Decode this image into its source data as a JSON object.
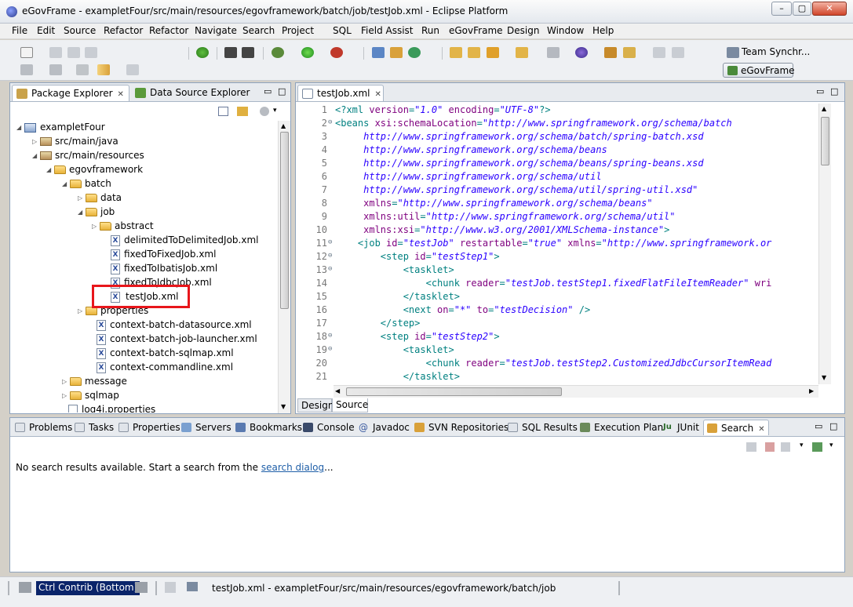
{
  "window": {
    "title": "eGovFrame - exampletFour/src/main/resources/egovframework/batch/job/testJob.xml - Eclipse Platform"
  },
  "menu": [
    "File",
    "Edit",
    "Source",
    "Refactor",
    "Refactor",
    "Navigate",
    "Search",
    "Project",
    "SQL",
    "Field Assist",
    "Run",
    "eGovFrame",
    "Design",
    "Window",
    "Help"
  ],
  "perspectives": {
    "team": "Team Synchr...",
    "egov": "eGovFrame"
  },
  "left_panel": {
    "tabs": [
      "Package Explorer",
      "Data Source Explorer"
    ],
    "tree": [
      {
        "label": "exampletFour",
        "type": "project",
        "expanded": true
      },
      {
        "label": "src/main/java",
        "type": "pkg",
        "expanded": false
      },
      {
        "label": "src/main/resources",
        "type": "pkg",
        "expanded": true
      },
      {
        "label": "egovframework",
        "type": "folder",
        "expanded": true
      },
      {
        "label": "batch",
        "type": "folder",
        "expanded": true
      },
      {
        "label": "data",
        "type": "folder",
        "expanded": false
      },
      {
        "label": "job",
        "type": "folder",
        "expanded": true
      },
      {
        "label": "abstract",
        "type": "folder",
        "expanded": false
      },
      {
        "label": "delimitedToDelimitedJob.xml",
        "type": "xml"
      },
      {
        "label": "fixedToFixedJob.xml",
        "type": "xml"
      },
      {
        "label": "fixedToIbatisJob.xml",
        "type": "xml"
      },
      {
        "label": "fixedToJdbcJob.xml",
        "type": "xml"
      },
      {
        "label": "testJob.xml",
        "type": "xml",
        "selected": true
      },
      {
        "label": "properties",
        "type": "folder",
        "expanded": false
      },
      {
        "label": "context-batch-datasource.xml",
        "type": "xml"
      },
      {
        "label": "context-batch-job-launcher.xml",
        "type": "xml"
      },
      {
        "label": "context-batch-sqlmap.xml",
        "type": "xml"
      },
      {
        "label": "context-commandline.xml",
        "type": "xml"
      },
      {
        "label": "message",
        "type": "folder",
        "expanded": false
      },
      {
        "label": "sqlmap",
        "type": "folder",
        "expanded": false
      },
      {
        "label": "log4j.properties",
        "type": "file"
      }
    ]
  },
  "editor": {
    "tab": "testJob.xml",
    "bottom_tabs": [
      "Design",
      "Source"
    ],
    "lines": [
      {
        "n": "1",
        "fold": "",
        "tokens": [
          [
            "p",
            "<?xml "
          ],
          [
            "a",
            "version"
          ],
          [
            "p",
            "="
          ],
          [
            "v",
            "\"1.0\""
          ],
          [
            "p",
            " "
          ],
          [
            "a",
            "encoding"
          ],
          [
            "p",
            "="
          ],
          [
            "v",
            "\"UTF-8\""
          ],
          [
            "p",
            "?>"
          ]
        ]
      },
      {
        "n": "2",
        "fold": "⊖",
        "tokens": [
          [
            "p",
            "<beans "
          ],
          [
            "a",
            "xsi:schemaLocation"
          ],
          [
            "p",
            "="
          ],
          [
            "u",
            "\"http://www.springframework.org/schema/batch"
          ]
        ]
      },
      {
        "n": "3",
        "fold": "",
        "tokens": [
          [
            "u",
            "     http://www.springframework.org/schema/batch/spring-batch.xsd"
          ]
        ]
      },
      {
        "n": "4",
        "fold": "",
        "tokens": [
          [
            "u",
            "     http://www.springframework.org/schema/beans"
          ]
        ]
      },
      {
        "n": "5",
        "fold": "",
        "tokens": [
          [
            "u",
            "     http://www.springframework.org/schema/beans/spring-beans.xsd"
          ]
        ]
      },
      {
        "n": "6",
        "fold": "",
        "tokens": [
          [
            "u",
            "     http://www.springframework.org/schema/util"
          ]
        ]
      },
      {
        "n": "7",
        "fold": "",
        "tokens": [
          [
            "u",
            "     http://www.springframework.org/schema/util/spring-util.xsd\""
          ]
        ]
      },
      {
        "n": "8",
        "fold": "",
        "tokens": [
          [
            "p",
            "     "
          ],
          [
            "a",
            "xmlns"
          ],
          [
            "p",
            "="
          ],
          [
            "u",
            "\"http://www.springframework.org/schema/beans\""
          ]
        ]
      },
      {
        "n": "9",
        "fold": "",
        "tokens": [
          [
            "p",
            "     "
          ],
          [
            "a",
            "xmlns:util"
          ],
          [
            "p",
            "="
          ],
          [
            "u",
            "\"http://www.springframework.org/schema/util\""
          ]
        ]
      },
      {
        "n": "10",
        "fold": "",
        "tokens": [
          [
            "p",
            "     "
          ],
          [
            "a",
            "xmlns:xsi"
          ],
          [
            "p",
            "="
          ],
          [
            "u",
            "\"http://www.w3.org/2001/XMLSchema-instance\""
          ],
          [
            "p",
            ">"
          ]
        ]
      },
      {
        "n": "11",
        "fold": "⊖",
        "tokens": [
          [
            "p",
            "    <job "
          ],
          [
            "a",
            "id"
          ],
          [
            "p",
            "="
          ],
          [
            "v",
            "\"testJob\""
          ],
          [
            "p",
            " "
          ],
          [
            "a",
            "restartable"
          ],
          [
            "p",
            "="
          ],
          [
            "v",
            "\"true\""
          ],
          [
            "p",
            " "
          ],
          [
            "a",
            "xmlns"
          ],
          [
            "p",
            "="
          ],
          [
            "u",
            "\"http://www.springframework.or"
          ]
        ]
      },
      {
        "n": "12",
        "fold": "⊖",
        "tokens": [
          [
            "p",
            "        <step "
          ],
          [
            "a",
            "id"
          ],
          [
            "p",
            "="
          ],
          [
            "v",
            "\"testStep1\""
          ],
          [
            "p",
            ">"
          ]
        ]
      },
      {
        "n": "13",
        "fold": "⊖",
        "tokens": [
          [
            "p",
            "            <tasklet>"
          ]
        ]
      },
      {
        "n": "14",
        "fold": "",
        "tokens": [
          [
            "p",
            "                <chunk "
          ],
          [
            "a",
            "reader"
          ],
          [
            "p",
            "="
          ],
          [
            "v",
            "\"testJob.testStep1.fixedFlatFileItemReader\""
          ],
          [
            "p",
            " "
          ],
          [
            "a",
            "wri"
          ]
        ]
      },
      {
        "n": "15",
        "fold": "",
        "tokens": [
          [
            "p",
            "            </tasklet>"
          ]
        ]
      },
      {
        "n": "16",
        "fold": "",
        "tokens": [
          [
            "p",
            "            <next "
          ],
          [
            "a",
            "on"
          ],
          [
            "p",
            "="
          ],
          [
            "v",
            "\"*\""
          ],
          [
            "p",
            " "
          ],
          [
            "a",
            "to"
          ],
          [
            "p",
            "="
          ],
          [
            "v",
            "\"testDecision\""
          ],
          [
            "p",
            " />"
          ]
        ]
      },
      {
        "n": "17",
        "fold": "",
        "tokens": [
          [
            "p",
            "        </step>"
          ]
        ]
      },
      {
        "n": "18",
        "fold": "⊖",
        "tokens": [
          [
            "p",
            "        <step "
          ],
          [
            "a",
            "id"
          ],
          [
            "p",
            "="
          ],
          [
            "v",
            "\"testStep2\""
          ],
          [
            "p",
            ">"
          ]
        ]
      },
      {
        "n": "19",
        "fold": "⊖",
        "tokens": [
          [
            "p",
            "            <tasklet>"
          ]
        ]
      },
      {
        "n": "20",
        "fold": "",
        "tokens": [
          [
            "p",
            "                <chunk "
          ],
          [
            "a",
            "reader"
          ],
          [
            "p",
            "="
          ],
          [
            "v",
            "\"testJob.testStep2.CustomizedJdbcCursorItemRead"
          ]
        ]
      },
      {
        "n": "21",
        "fold": "",
        "tokens": [
          [
            "p",
            "            </tasklet>"
          ]
        ]
      }
    ]
  },
  "bottom_panel": {
    "tabs": [
      "Problems",
      "Tasks",
      "Properties",
      "Servers",
      "Bookmarks",
      "Console",
      "Javadoc",
      "SVN Repositories",
      "SQL Results",
      "Execution Plan",
      "JUnit",
      "Search"
    ],
    "message_prefix": "No search results available. Start a search from the ",
    "message_link": "search dialog",
    "message_suffix": "..."
  },
  "status": {
    "contrib": "Ctrl Contrib (Bottom)",
    "path": "testJob.xml - exampletFour/src/main/resources/egovframework/batch/job"
  },
  "colors": {
    "selection_box": "#e8161b",
    "link": "#1f5fa8",
    "attr": "#7f007f",
    "value": "#2a00ff",
    "tag": "#008080"
  }
}
